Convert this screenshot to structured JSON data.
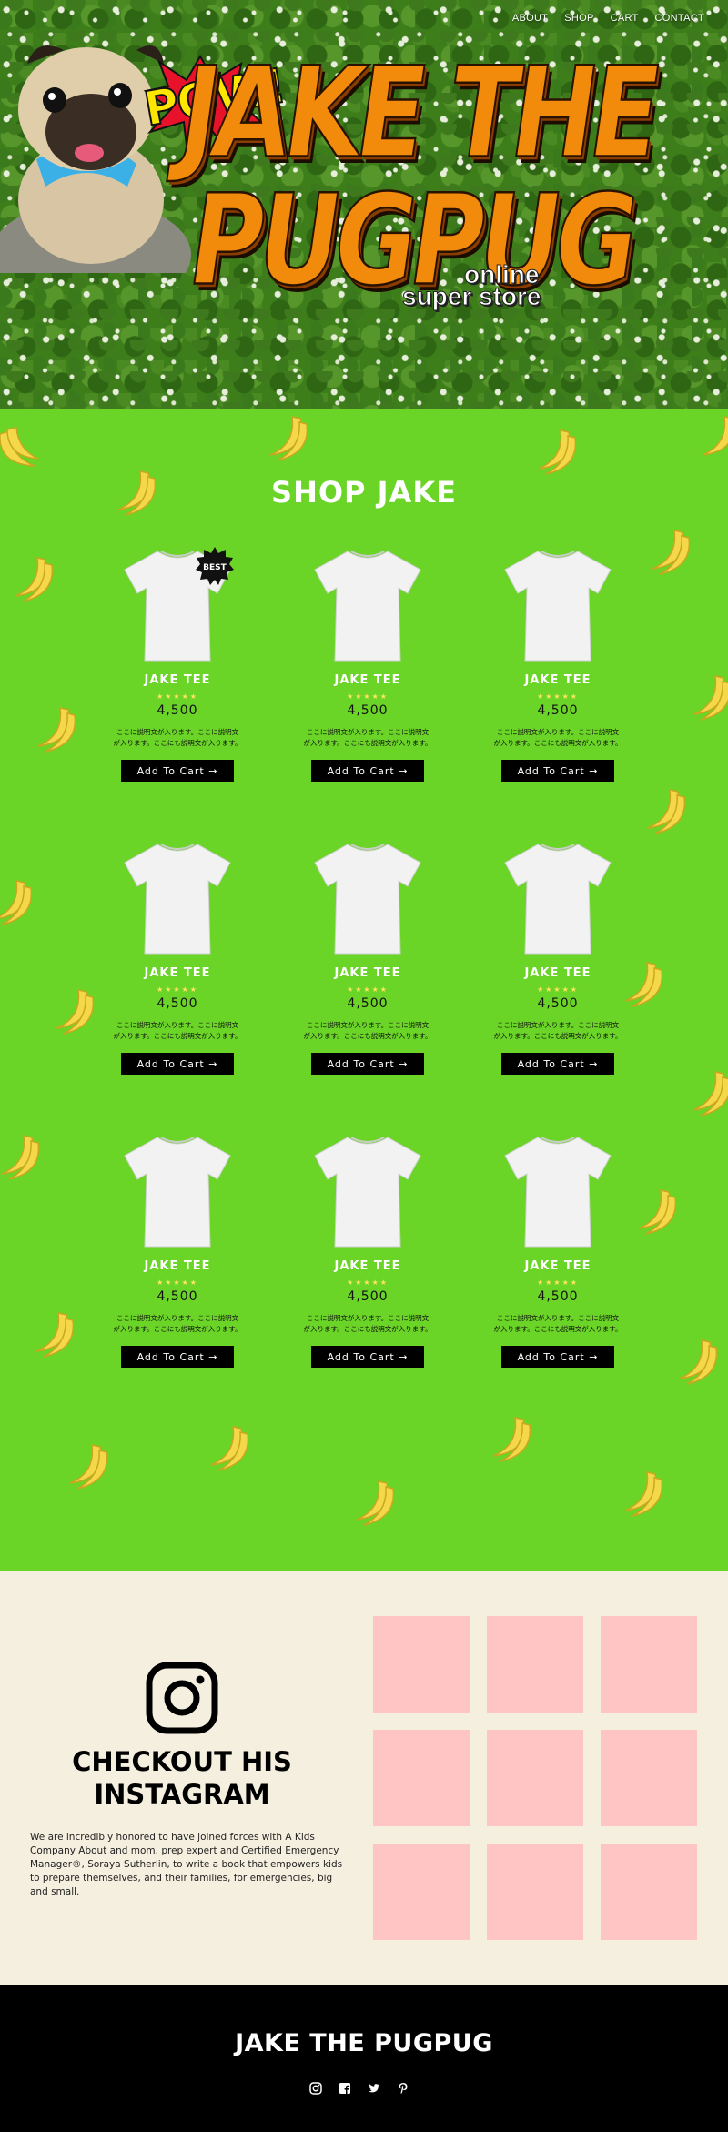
{
  "nav": {
    "items": [
      "ABOUT",
      "SHOP",
      "CART",
      "CONTACT"
    ]
  },
  "hero": {
    "pow": "POW!",
    "logo_line1": "JAKE THE",
    "logo_line2": "PUGPUG",
    "tagline1": "online",
    "tagline2": "super store"
  },
  "shop": {
    "title": "SHOP JAKE",
    "badge": "BEST",
    "products": [
      {
        "name": "JAKE TEE",
        "stars": "★★★★★",
        "price": "4,500",
        "desc1": "ここに説明文が入ります。ここに説明文",
        "desc2": "が入ります。ここにも説明文が入ります。",
        "button": "Add To Cart →"
      },
      {
        "name": "JAKE TEE",
        "stars": "★★★★★",
        "price": "4,500",
        "desc1": "ここに説明文が入ります。ここに説明文",
        "desc2": "が入ります。ここにも説明文が入ります。",
        "button": "Add To Cart →"
      },
      {
        "name": "JAKE TEE",
        "stars": "★★★★★",
        "price": "4,500",
        "desc1": "ここに説明文が入ります。ここに説明文",
        "desc2": "が入ります。ここにも説明文が入ります。",
        "button": "Add To Cart →"
      },
      {
        "name": "JAKE TEE",
        "stars": "★★★★★",
        "price": "4,500",
        "desc1": "ここに説明文が入ります。ここに説明文",
        "desc2": "が入ります。ここにも説明文が入ります。",
        "button": "Add To Cart →"
      },
      {
        "name": "JAKE TEE",
        "stars": "★★★★★",
        "price": "4,500",
        "desc1": "ここに説明文が入ります。ここに説明文",
        "desc2": "が入ります。ここにも説明文が入ります。",
        "button": "Add To Cart →"
      },
      {
        "name": "JAKE TEE",
        "stars": "★★★★★",
        "price": "4,500",
        "desc1": "ここに説明文が入ります。ここに説明文",
        "desc2": "が入ります。ここにも説明文が入ります。",
        "button": "Add To Cart →"
      },
      {
        "name": "JAKE TEE",
        "stars": "★★★★★",
        "price": "4,500",
        "desc1": "ここに説明文が入ります。ここに説明文",
        "desc2": "が入ります。ここにも説明文が入ります。",
        "button": "Add To Cart →"
      },
      {
        "name": "JAKE TEE",
        "stars": "★★★★★",
        "price": "4,500",
        "desc1": "ここに説明文が入ります。ここに説明文",
        "desc2": "が入ります。ここにも説明文が入ります。",
        "button": "Add To Cart →"
      },
      {
        "name": "JAKE TEE",
        "stars": "★★★★★",
        "price": "4,500",
        "desc1": "ここに説明文が入ります。ここに説明文",
        "desc2": "が入ります。ここにも説明文が入ります。",
        "button": "Add To Cart →"
      }
    ]
  },
  "instagram": {
    "title_line1": "CHECKOUT HIS",
    "title_line2": "INSTAGRAM",
    "body": "We are incredibly honored to have joined forces with A Kids Company About and mom, prep expert and Certified Emergency Manager®, Soraya Sutherlin, to write a book that empowers kids to prepare themselves, and their families, for emergencies, big and small."
  },
  "footer": {
    "title": "JAKE THE PUGPUG",
    "socials": [
      "instagram-icon",
      "facebook-icon",
      "twitter-icon",
      "pinterest-icon"
    ]
  },
  "colors": {
    "shop_bg": "#6ad427",
    "logo_orange": "#f28a0c",
    "pow_yellow": "#ffe600",
    "banana": "#f5d84a",
    "insta_bg": "#f5efdf",
    "tile_pink": "#ffc4c4",
    "footer_bg": "#000000"
  }
}
